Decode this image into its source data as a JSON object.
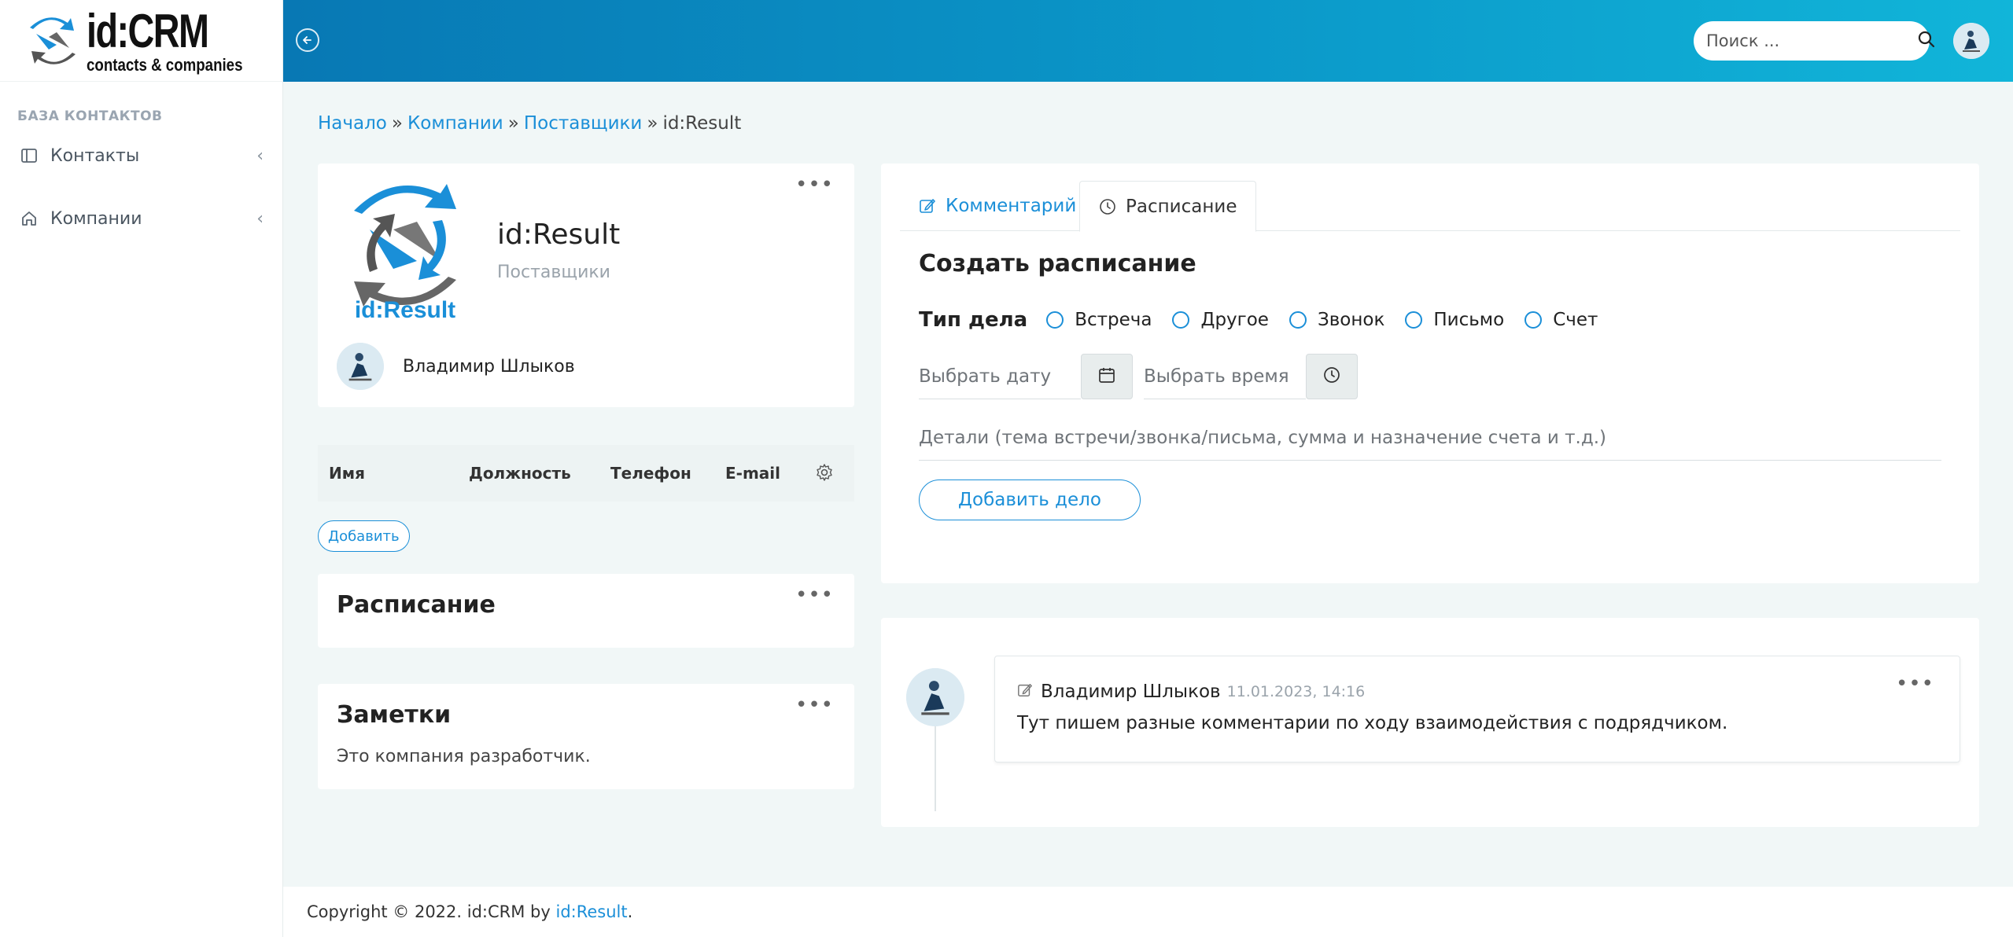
{
  "brand": {
    "title": "id:CRM",
    "subtitle": "contacts & companies"
  },
  "sidebar": {
    "section": "БАЗА КОНТАКТОВ",
    "items": [
      {
        "label": "Контакты",
        "icon": "sidebar-panel-icon"
      },
      {
        "label": "Компании",
        "icon": "home-icon"
      }
    ]
  },
  "topbar": {
    "search_placeholder": "Поиск ...",
    "accent": "#0b98c9"
  },
  "breadcrumb": {
    "items": [
      "Начало",
      "Компании",
      "Поставщики"
    ],
    "current": "id:Result"
  },
  "company": {
    "name": "id:Result",
    "type": "Поставщики",
    "owner": "Владимир Шлыков",
    "logo_text": "id:Result"
  },
  "contacts_table": {
    "columns": [
      "Имя",
      "Должность",
      "Телефон",
      "E-mail"
    ],
    "add_label": "Добавить"
  },
  "schedule_card": {
    "title": "Расписание"
  },
  "notes_card": {
    "title": "Заметки",
    "text": "Это компания разработчик."
  },
  "tabs": [
    {
      "label": "Комментарий",
      "icon": "edit-icon",
      "active": false
    },
    {
      "label": "Расписание",
      "icon": "clock-icon",
      "active": true
    }
  ],
  "schedule_form": {
    "title": "Создать расписание",
    "type_label": "Тип дела",
    "types": [
      "Встреча",
      "Другое",
      "Звонок",
      "Письмо",
      "Счет"
    ],
    "date_placeholder": "Выбрать дату",
    "time_placeholder": "Выбрать время",
    "details_placeholder": "Детали (тема встречи/звонка/письма, сумма и назначение счета и т.д.)",
    "submit_label": "Добавить дело"
  },
  "timeline": {
    "comment": {
      "author": "Владимир Шлыков",
      "date": "11.01.2023, 14:16",
      "text": "Тут пишем разные комментарии по ходу взаимодействия с подрядчиком."
    }
  },
  "footer": {
    "text": "Copyright © 2022. id:CRM by ",
    "link": "id:Result",
    "suffix": "."
  }
}
